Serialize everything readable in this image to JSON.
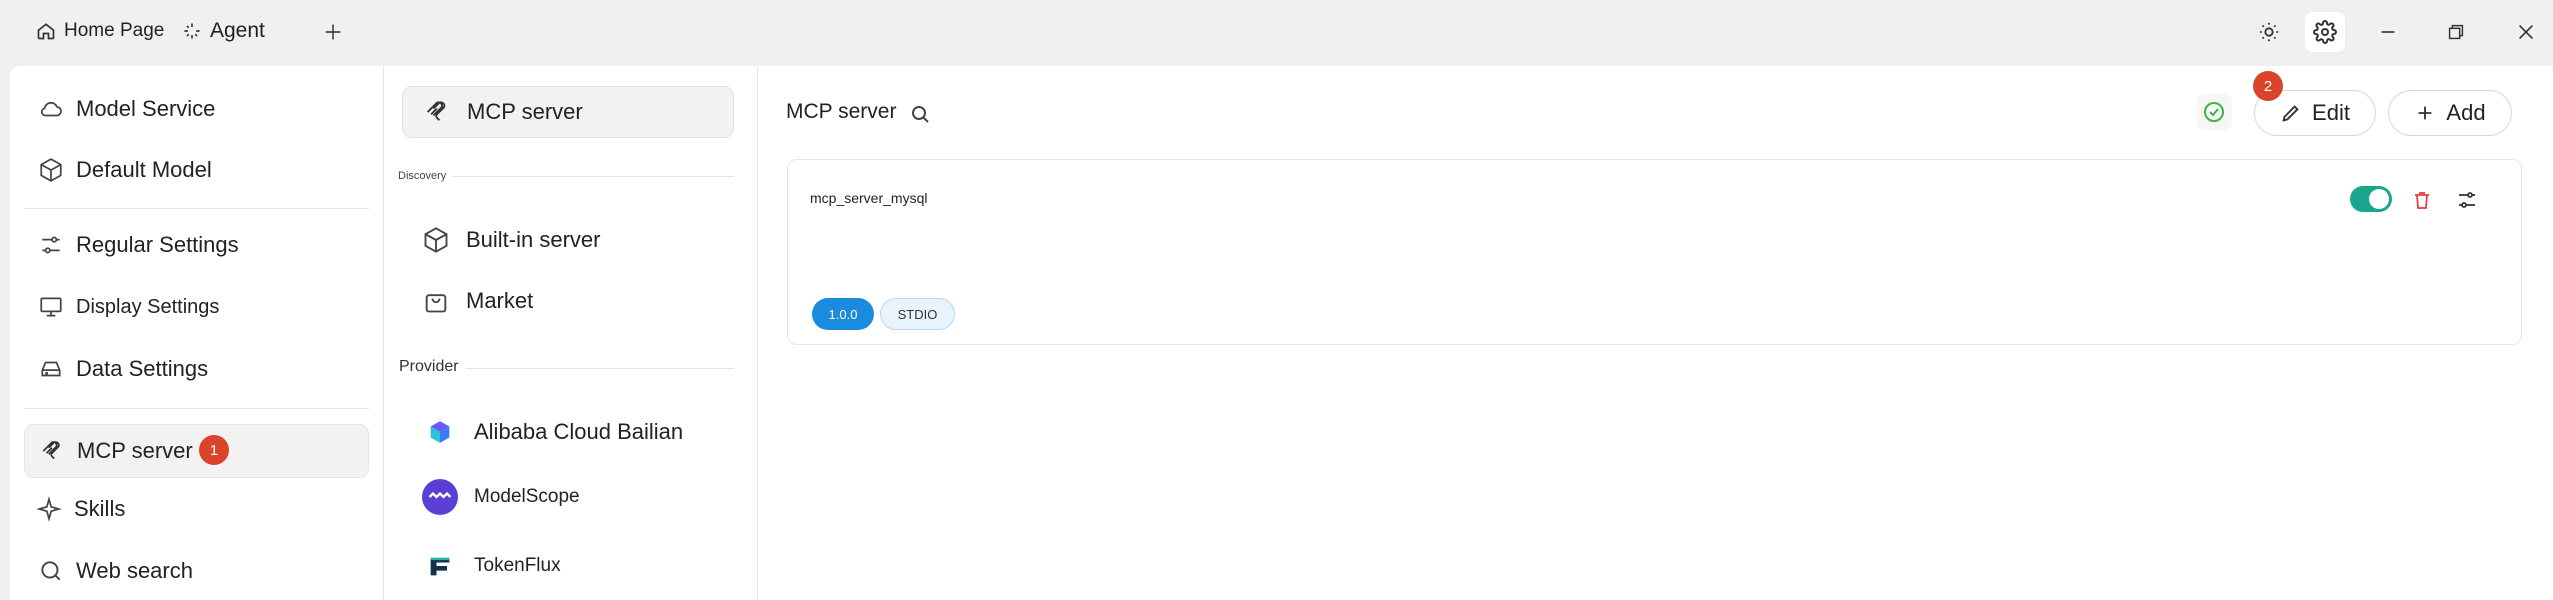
{
  "titlebar": {
    "tabs": [
      {
        "label": "Home Page",
        "icon": "home-icon"
      },
      {
        "label": "Agent",
        "icon": "sparkle-icon"
      }
    ],
    "add_tab_icon": "plus-icon",
    "controls": [
      "sun-icon",
      "gear-icon",
      "minimize-icon",
      "restore-icon",
      "close-icon"
    ]
  },
  "sidebar": {
    "items": [
      {
        "label": "Model Service",
        "icon": "cloud-icon"
      },
      {
        "label": "Default Model",
        "icon": "cube-icon"
      },
      {
        "label": "Regular Settings",
        "icon": "sliders-icon"
      },
      {
        "label": "Display Settings",
        "icon": "monitor-icon"
      },
      {
        "label": "Data Settings",
        "icon": "hard-drive-icon"
      },
      {
        "label": "MCP server",
        "icon": "mcp-icon",
        "active": true,
        "badge": "1"
      },
      {
        "label": "Skills",
        "icon": "sparkle-icon"
      },
      {
        "label": "Web search",
        "icon": "search-icon"
      }
    ]
  },
  "middle": {
    "top_item": "MCP server",
    "discovery_label": "Discovery",
    "discovery_items": [
      "Built-in server",
      "Market"
    ],
    "provider_label": "Provider",
    "providers": [
      "Alibaba Cloud Bailian",
      "ModelScope",
      "TokenFlux"
    ]
  },
  "main": {
    "title": "MCP server",
    "edit_label": "Edit",
    "edit_badge": "2",
    "add_label": "Add",
    "servers": [
      {
        "name": "mcp_server_mysql",
        "version": "1.0.0",
        "type": "STDIO",
        "enabled": true
      }
    ]
  },
  "colors": {
    "accent_green": "#1aa58e",
    "badge_red": "#d9442b",
    "version_blue": "#1b8be0",
    "delete_red": "#e0413a"
  }
}
